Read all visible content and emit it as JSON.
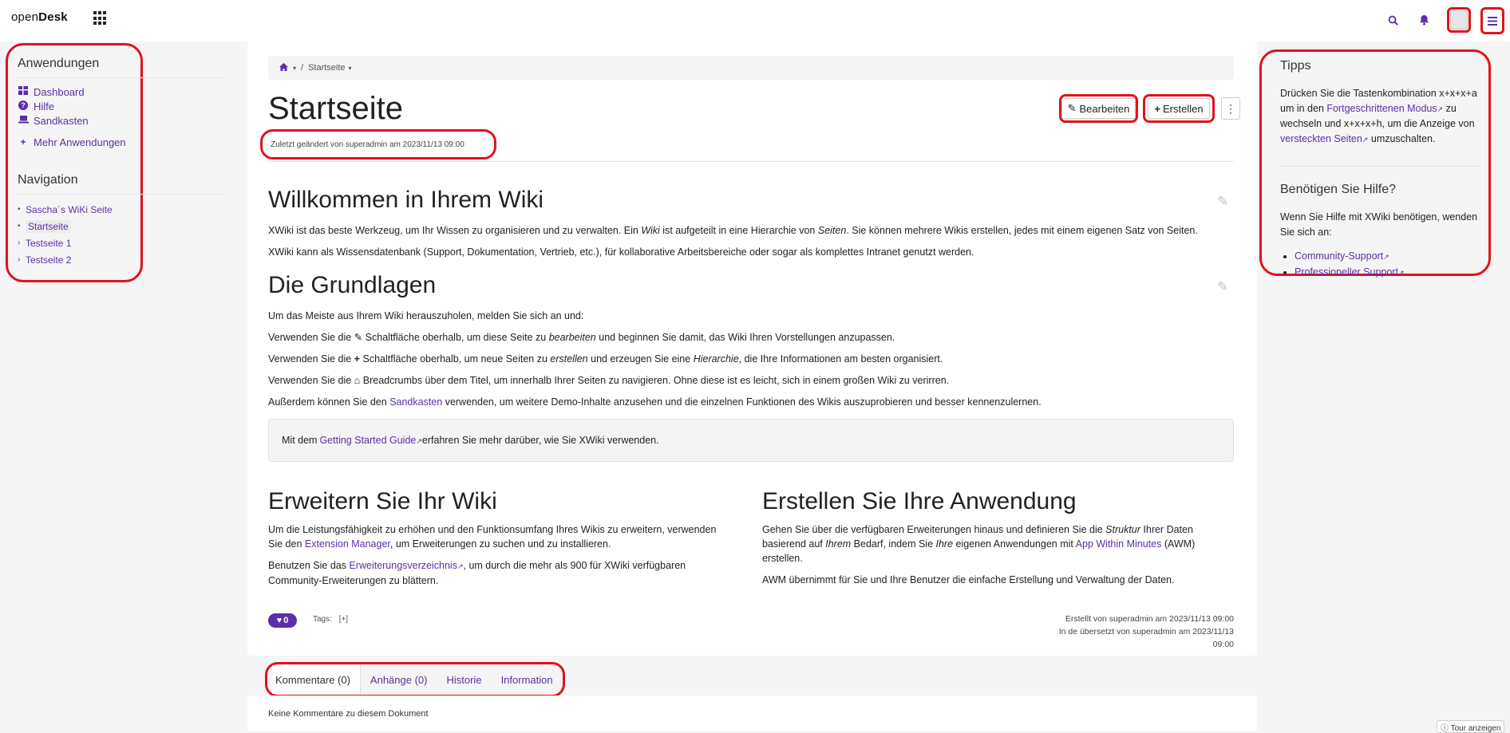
{
  "topbar": {
    "logo_light": "open",
    "logo_bold": "Desk"
  },
  "left_panel": {
    "apps_title": "Anwendungen",
    "apps": [
      {
        "label": "Dashboard",
        "icon": "dashboard-icon"
      },
      {
        "label": "Hilfe",
        "icon": "question-circle-icon"
      },
      {
        "label": "Sandkasten",
        "icon": "laptop-icon"
      }
    ],
    "more_apps": "Mehr Anwendungen",
    "nav_title": "Navigation",
    "nav": [
      {
        "label": "Sascha´s WiKi Seite",
        "marker": "•"
      },
      {
        "label": "Startseite",
        "marker": "•"
      },
      {
        "label": "Testseite 1",
        "marker": "›"
      },
      {
        "label": "Testseite 2",
        "marker": "›"
      }
    ]
  },
  "main": {
    "breadcrumb": "Startseite",
    "title": "Startseite",
    "edit_label": "Bearbeiten",
    "create_label": "Erstellen",
    "last_modified": "Zuletzt geändert von superadmin am 2023/11/13 09:00",
    "s1_title": "Willkommen in Ihrem Wiki",
    "s1_p1": {
      "a": "XWiki ist das beste Werkzeug, um Ihr Wissen zu organisieren und zu verwalten. Ein ",
      "b": "Wiki",
      "c": " ist aufgeteilt in eine Hierarchie von ",
      "d": "Seiten",
      "e": ". Sie können mehrere Wikis erstellen, jedes mit einem eigenen Satz von Seiten."
    },
    "s1_p2": "XWiki kann als Wissensdatenbank (Support, Dokumentation, Vertrieb, etc.), für kollaborative Arbeitsbereiche oder sogar als komplettes Intranet genutzt werden.",
    "s2_title": "Die Grundlagen",
    "s2_p1": "Um das Meiste aus Ihrem Wiki herauszuholen, melden Sie sich an und:",
    "s2_p2": {
      "a": "Verwenden Sie die ",
      "b": " Schaltfläche oberhalb, um diese Seite zu ",
      "c": "bearbeiten",
      "d": " und beginnen Sie damit, das Wiki Ihren Vorstellungen anzupassen."
    },
    "s2_p3": {
      "a": "Verwenden Sie die ",
      "b": " Schaltfläche oberhalb, um neue Seiten zu ",
      "c": "erstellen",
      "d": " und erzeugen Sie eine ",
      "e": "Hierarchie",
      "f": ", die Ihre Informationen am besten organisiert."
    },
    "s2_p4": {
      "a": "Verwenden Sie die ",
      "b": " Breadcrumbs über dem Titel, um innerhalb Ihrer Seiten zu navigieren. Ohne diese ist es leicht, sich in einem großen Wiki zu verirren."
    },
    "s2_p5": {
      "a": "Außerdem können Sie den ",
      "link": "Sandkasten",
      "b": " verwenden, um weitere Demo-Inhalte anzusehen und die einzelnen Funktionen des Wikis auszuprobieren und besser kennenzulernen."
    },
    "info": {
      "a": "Mit dem ",
      "link": "Getting Started Guide",
      "b": " erfahren Sie mehr darüber, wie Sie XWiki verwenden."
    },
    "s3_title": "Erweitern Sie Ihr Wiki",
    "s3_p1": {
      "a": "Um die Leistungsfähigkeit zu erhöhen und den Funktionsumfang Ihres Wikis zu erweitern, verwenden Sie den ",
      "link": "Extension Manager",
      "b": ", um Erweiterungen zu suchen und zu installieren."
    },
    "s3_p2": {
      "a": "Benutzen Sie das ",
      "link": "Erweiterungsverzeichnis",
      "b": ", um durch die mehr als 900 für XWiki verfügbaren Community-Erweiterungen zu blättern."
    },
    "s4_title": "Erstellen Sie Ihre Anwendung",
    "s4_p1": {
      "a": "Gehen Sie über die verfügbaren Erweiterungen hinaus und definieren Sie die ",
      "b": "Struktur",
      "c": " Ihrer Daten basierend auf ",
      "d": "Ihrem",
      "e": " Bedarf, indem Sie ",
      "f": "Ihre",
      "g": " eigenen Anwendungen mit ",
      "link": "App Within Minutes",
      "h": " (AWM) erstellen."
    },
    "s4_p2": "AWM übernimmt für Sie und Ihre Benutzer die einfache Erstellung und Verwaltung der Daten.",
    "likes": "0",
    "tags_label": "Tags:",
    "tags_add": "[+]",
    "created": "Erstellt von superadmin am 2023/11/13 09:00",
    "translated": "In de übersetzt von superadmin am 2023/11/13 09:00"
  },
  "tabs": [
    {
      "label": "Kommentare (0)"
    },
    {
      "label": "Anhänge (0)"
    },
    {
      "label": "Historie"
    },
    {
      "label": "Information"
    }
  ],
  "comments": {
    "none": "Keine Kommentare zu diesem Dokument"
  },
  "right_panel": {
    "tips_title": "Tipps",
    "tips": {
      "a": "Drücken Sie die Tastenkombination x+x+x+a um in den ",
      "link1": "Fortgeschrittenen Modus",
      "b": " zu wechseln und x+x+x+h, um die Anzeige von ",
      "link2": "versteckten Seiten",
      "c": " umzuschalten."
    },
    "help_title": "Benötigen Sie Hilfe?",
    "help_text": "Wenn Sie Hilfe mit XWiki benötigen, wenden Sie sich an:",
    "help_links": [
      "Community-Support",
      "Professioneller Support"
    ]
  },
  "tour": "Tour anzeigen",
  "colors": {
    "accent": "#5b2fa8",
    "annotation": "#e0131c"
  }
}
